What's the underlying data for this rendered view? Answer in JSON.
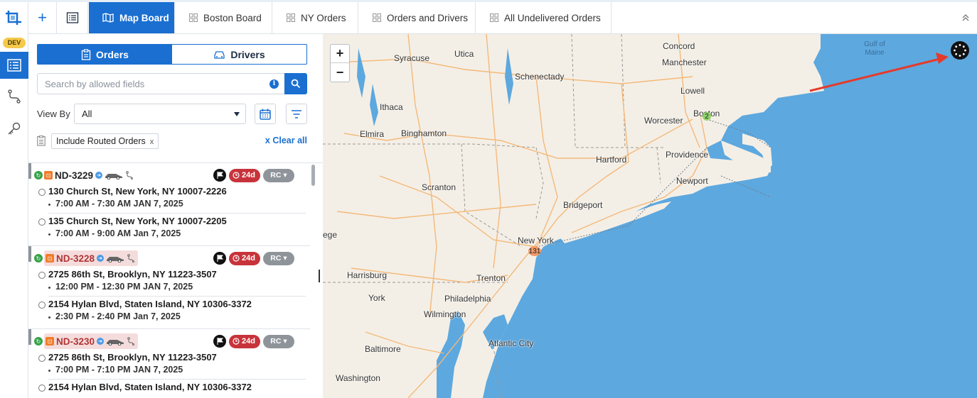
{
  "rail": {
    "dev_badge": "DEV",
    "icons": [
      "routes-logo-icon",
      "orders-board-icon",
      "route-path-icon",
      "key-icon"
    ]
  },
  "tabs": [
    {
      "label": "Map Board",
      "active": true,
      "icon": "map-icon"
    },
    {
      "label": "Boston Board",
      "active": false,
      "icon": "grid-icon"
    },
    {
      "label": "NY Orders",
      "active": false,
      "icon": "grid-icon"
    },
    {
      "label": "Orders and Drivers",
      "active": false,
      "icon": "grid-icon"
    },
    {
      "label": "All Undelivered Orders",
      "active": false,
      "icon": "grid-icon"
    }
  ],
  "panel": {
    "segments": {
      "orders": "Orders",
      "drivers": "Drivers",
      "active": "orders"
    },
    "search": {
      "placeholder": "Search by allowed fields"
    },
    "view_by": {
      "label": "View By",
      "value": "All"
    },
    "filters": {
      "chip": "Include Routed Orders",
      "chip_close": "x",
      "clear_all": "x Clear all"
    },
    "orders": [
      {
        "id": "ND-3229",
        "highlight": false,
        "age": "24d",
        "rc": "RC",
        "stops": [
          {
            "address": "130 Church St, New York, NY 10007-2226",
            "time": "7:00 AM - 7:30 AM JAN 7, 2025"
          },
          {
            "address": "135 Church St, New York, NY 10007-2205",
            "time": "7:00 AM - 9:00 AM Jan 7, 2025"
          }
        ]
      },
      {
        "id": "ND-3228",
        "highlight": true,
        "age": "24d",
        "rc": "RC",
        "stops": [
          {
            "address": "2725 86th St, Brooklyn, NY 11223-3507",
            "time": "12:00 PM - 12:30 PM JAN 7, 2025"
          },
          {
            "address": "2154 Hylan Blvd, Staten Island, NY 10306-3372",
            "time": "2:30 PM - 2:40 PM Jan 7, 2025"
          }
        ]
      },
      {
        "id": "ND-3230",
        "highlight": true,
        "age": "24d",
        "rc": "RC",
        "stops": [
          {
            "address": "2725 86th St, Brooklyn, NY 11223-3507",
            "time": "7:00 PM - 7:10 PM JAN 7, 2025"
          },
          {
            "address": "2154 Hylan Blvd, Staten Island, NY 10306-3372",
            "time": ""
          }
        ]
      }
    ]
  },
  "map": {
    "zoom_in": "+",
    "zoom_out": "−",
    "cities": [
      "Concord",
      "Syracuse",
      "Utica",
      "Manchester",
      "Schenectady",
      "Lowell",
      "Ithaca",
      "Boston",
      "Worcester",
      "Elmira",
      "Binghamton",
      "Providence",
      "Hartford",
      "Newport",
      "Scranton",
      "Bridgeport",
      "ege",
      "New York",
      "Harrisburg",
      "Trenton",
      "York",
      "Philadelphia",
      "Wilmington",
      "Atlantic City",
      "Baltimore",
      "Washington"
    ],
    "water_label": "Gulf of Maine",
    "clusters": [
      {
        "label": "2",
        "color": "#8fd36b"
      },
      {
        "label": "131",
        "color": "#f09a6a"
      }
    ],
    "colors": {
      "water": "#5da8df",
      "land": "#f4efe6",
      "accent": "#1a6fd1",
      "annotation_arrow": "#e53a2a"
    }
  }
}
